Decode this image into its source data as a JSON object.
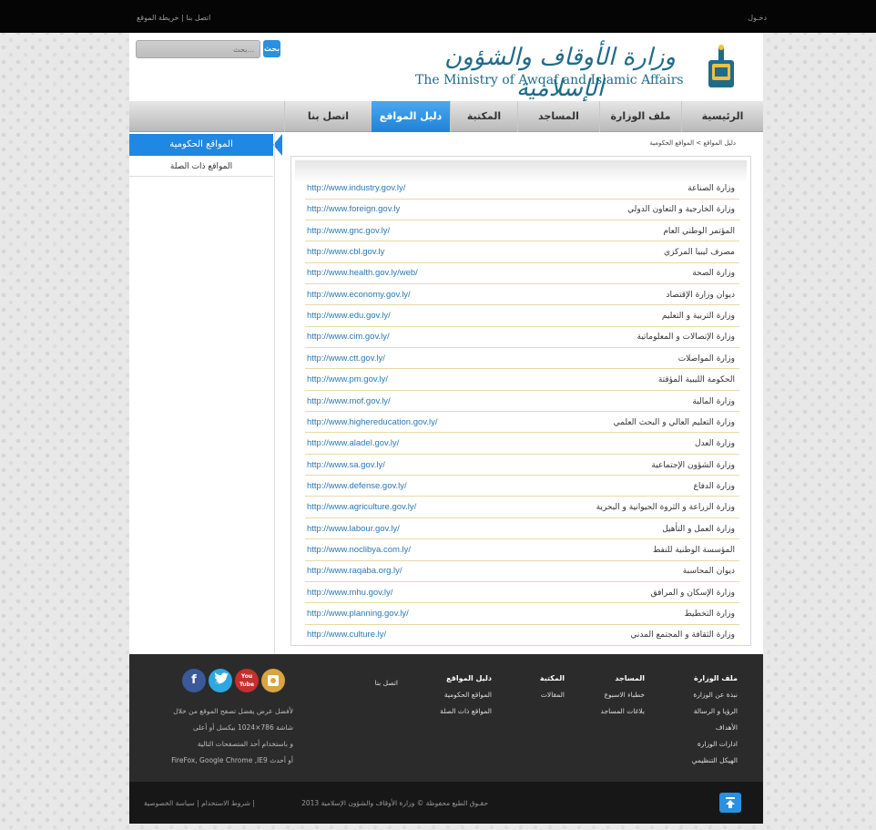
{
  "topbar": {
    "contact": "اتصل بنا",
    "separator": "|",
    "sitemap": "خريطة الموقع",
    "login": "دخـول"
  },
  "header": {
    "search_placeholder": "بحث...",
    "search_button": "بحث",
    "logo_ar": "وزارة الأوقاف والشؤون الإسلامية",
    "logo_en": "The Ministry of Awqaf and Islamic Affairs"
  },
  "nav": {
    "items": [
      {
        "label": "الرئيسية"
      },
      {
        "label": "ملف الوزارة"
      },
      {
        "label": "المساجد"
      },
      {
        "label": "المكتبة"
      },
      {
        "label": "دليل المواقع"
      },
      {
        "label": "اتصل بنا"
      }
    ]
  },
  "sidebar": {
    "active": "المواقع الحكومية",
    "item": "المواقع ذات الصلة"
  },
  "breadcrumb": "دليل المواقع  >  المواقع الحكومية",
  "links": [
    {
      "url": "http://www.industry.gov.ly/",
      "name": "وزارة الصناعة"
    },
    {
      "url": "http://www.foreign.gov.ly",
      "name": "وزارة الخارجية و التعاون الدولي"
    },
    {
      "url": "http://www.gnc.gov.ly/",
      "name": "المؤتمر الوطني العام"
    },
    {
      "url": "http://www.cbl.gov.ly",
      "name": "مصرف ليبيا المركزي"
    },
    {
      "url": "http://www.health.gov.ly/web/",
      "name": "وزارة الصحة"
    },
    {
      "url": "http://www.economy.gov.ly/",
      "name": "ديوان وزارة الإقتصاد"
    },
    {
      "url": "http://www.edu.gov.ly/",
      "name": "وزارة التربية و التعليم"
    },
    {
      "url": "http://www.cim.gov.ly/",
      "name": "وزارة الإتصالات و المعلوماتية"
    },
    {
      "url": "http://www.ctt.gov.ly/",
      "name": "وزارة المواصلات"
    },
    {
      "url": "http://www.pm.gov.ly/",
      "name": "الحكومة الليبية المؤقتة"
    },
    {
      "url": "http://www.mof.gov.ly/",
      "name": "وزارة المالية"
    },
    {
      "url": "http://www.highereducation.gov.ly/",
      "name": "وزارة التعليم العالي و البحث العلمي"
    },
    {
      "url": "http://www.aladel.gov.ly/",
      "name": "وزارة العدل"
    },
    {
      "url": "http://www.sa.gov.ly/",
      "name": "وزارة الشؤون الإجتماعية"
    },
    {
      "url": "http://www.defense.gov.ly/",
      "name": "وزارة الدفاع"
    },
    {
      "url": "http://www.agriculture.gov.ly/",
      "name": "وزارة الزراعة و الثروة الحيوانية و البحرية"
    },
    {
      "url": "http://www.labour.gov.ly/",
      "name": "وزارة العمل و التأهيل"
    },
    {
      "url": "http://www.noclibya.com.ly/",
      "name": "المؤسسة الوطنية للنفط"
    },
    {
      "url": "http://www.raqaba.org.ly/",
      "name": "ديوان المحاسبة"
    },
    {
      "url": "http://www.mhu.gov.ly/",
      "name": "وزارة الإسكان و المرافق"
    },
    {
      "url": "http://www.planning.gov.ly/",
      "name": "وزارة التخطيط"
    },
    {
      "url": "http://www.culture.ly/",
      "name": "وزارة الثقافة و المجتمع المدني"
    }
  ],
  "footer": {
    "col1": {
      "title": "ملف الوزارة",
      "items": [
        "نبذة عن الوزارة",
        "الرؤيا و الرسالة",
        "الأهداف",
        "ادارات الوزارة",
        "الهيكل التنظيمي"
      ]
    },
    "col2": {
      "title": "المساجد",
      "items": [
        "خطباء الاسبوع",
        "بلاغات المساجد"
      ]
    },
    "col3": {
      "title": "المكتبة",
      "items": [
        "المقالات"
      ]
    },
    "col4": {
      "title": "دليل المواقع",
      "items": [
        "المواقع الحكومية",
        "المواقع ذات الصلة"
      ]
    },
    "col5": {
      "title": "",
      "items": [
        "اتصل بنا"
      ]
    },
    "note1": "لأفضل عرض يفضل تصفح الموقع من خلال",
    "note2": "شاشة 786×1024 بيكسل أو أعلى",
    "note3": "و باستخدام أحد المتصفحات التالية",
    "note4": "FireFox, Google Chrome ,IE9 أو أحدث",
    "social": {
      "facebook": "f",
      "youtube": "You Tube"
    }
  },
  "bottom": {
    "copyright": "حقـوق الطبع محفوظة © وزارة الأوقاف والشؤون الإسلامية 2013",
    "privacy": "سياسة الخصوصية",
    "terms": "شروط الاستخدام",
    "sep": "|"
  },
  "colors": {
    "accent": "#1f88e5",
    "dark": "#2b2b2b",
    "link": "#2b78b5"
  }
}
